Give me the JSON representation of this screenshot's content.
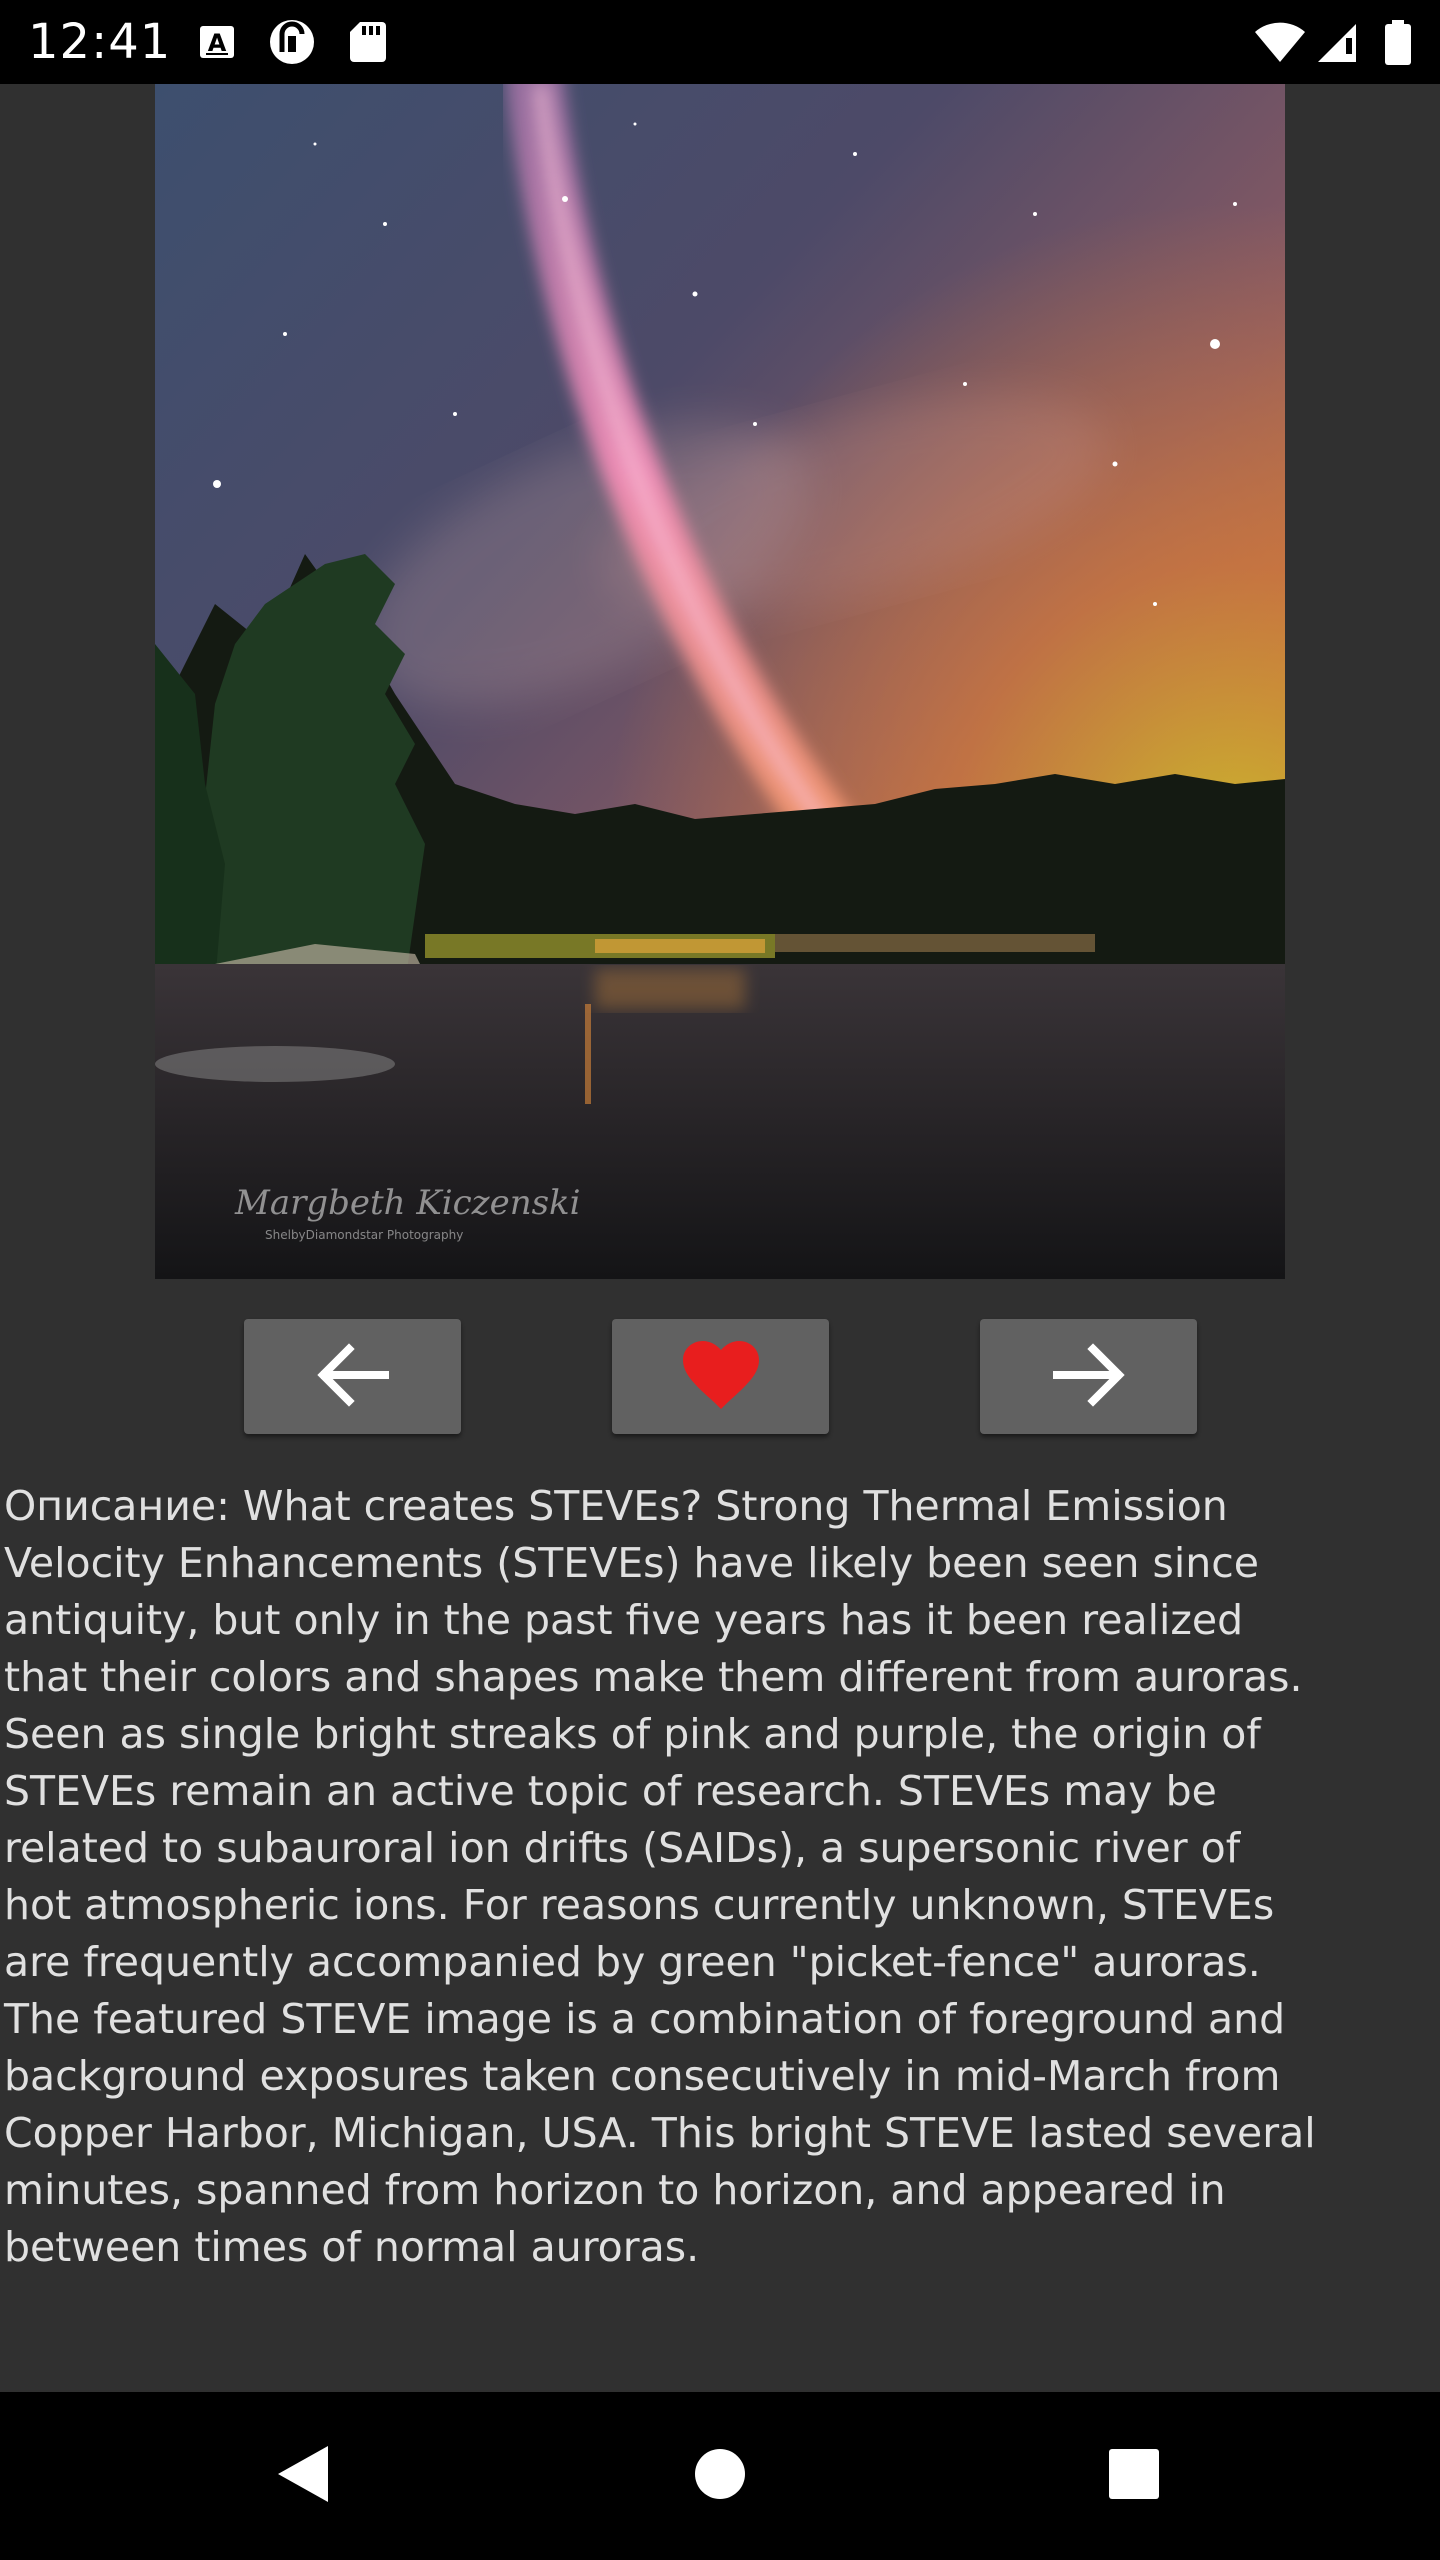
{
  "status_bar": {
    "time": "12:41",
    "left_icons": [
      "text-a-icon",
      "pocket-casts-icon",
      "sd-card-icon"
    ],
    "right_icons": [
      "wifi-icon",
      "signal-icon",
      "battery-icon"
    ]
  },
  "photo": {
    "watermark_signature": "Margbeth Kiczenski",
    "watermark_credit": "ShelbyDiamondstar Photography"
  },
  "controls": {
    "prev_icon": "arrow-left-icon",
    "favorite_icon": "heart-icon",
    "next_icon": "arrow-right-icon",
    "favorite_color": "#e81e1e"
  },
  "description": {
    "text": "Описание: What creates STEVEs? Strong Thermal Emission\nVelocity Enhancements (STEVEs) have likely been seen since\nantiquity, but only in the past five years has it been realized\nthat their colors and shapes make them different from auroras.\nSeen as single bright streaks of pink and purple, the origin of\nSTEVEs remain an active topic of research. STEVEs may be\nrelated to subauroral ion drifts (SAIDs), a supersonic river of\nhot atmospheric ions. For reasons currently unknown, STEVEs\nare frequently accompanied by green \"picket-fence\" auroras.\nThe featured STEVE image is a combination of foreground and\nbackground exposures taken consecutively in mid-March from\nCopper Harbor, Michigan, USA. This bright STEVE lasted several\nminutes, spanned from horizon to horizon, and appeared in\nbetween times of normal auroras."
  },
  "nav_bar": {
    "back_icon": "back-triangle-icon",
    "home_icon": "home-circle-icon",
    "recents_icon": "recents-square-icon"
  },
  "colors": {
    "background": "#303030",
    "button": "#616161",
    "text": "#e0e0e0"
  }
}
